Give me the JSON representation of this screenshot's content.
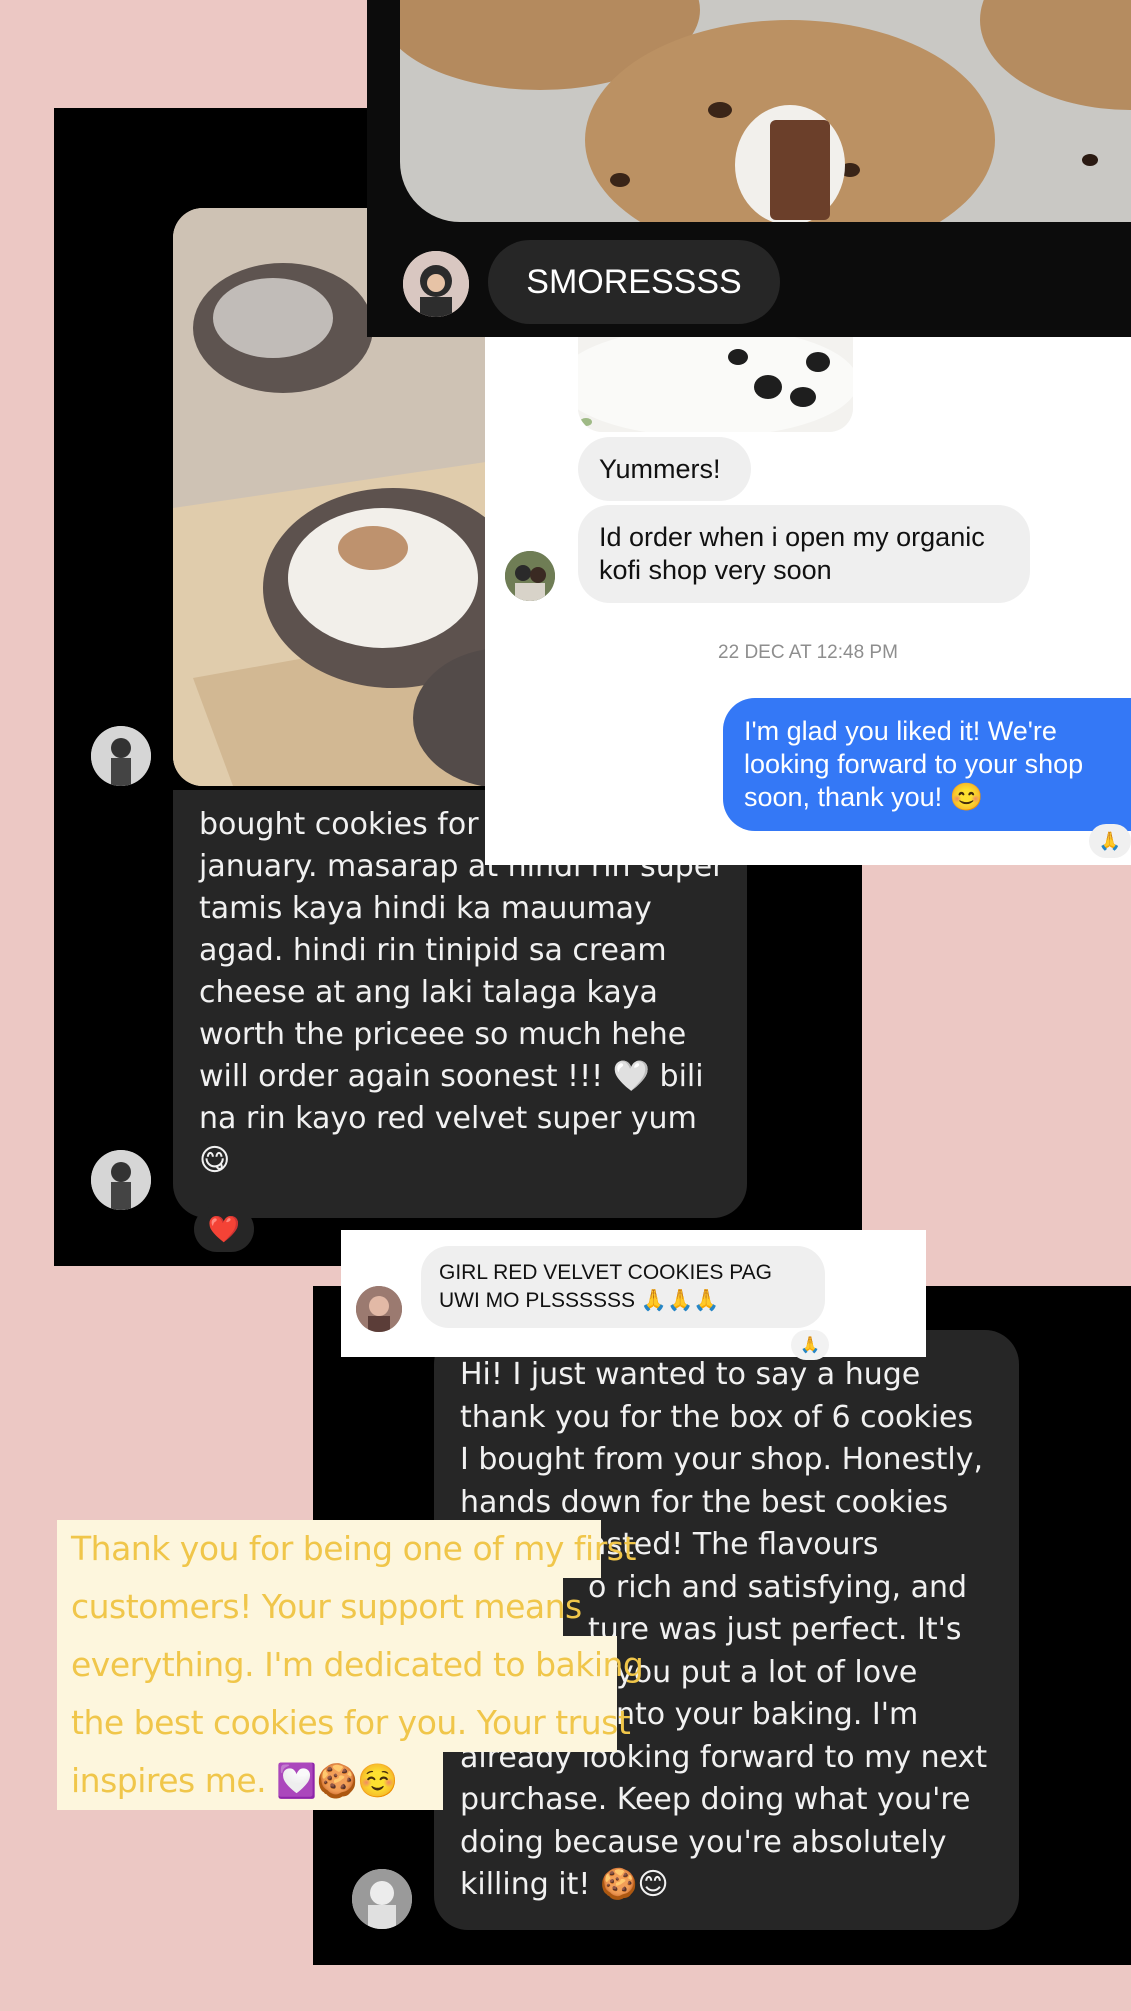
{
  "top_chat": {
    "caption": "SMORESSSS"
  },
  "left_chat": {
    "message": "bought cookies for my family last january. masarap at hindi rin super tamis kaya hindi ka mauumay agad. hindi rin tinipid sa cream cheese at ang laki talaga kaya worth the priceee so much hehe will order again soonest !!! 🤍 bili na rin kayo red velvet super yum 😋",
    "message_lines": [
      "bought cookies for",
      "january. masarap at hindi rin super",
      "tamis kaya hindi ka mauumay",
      "agad. hindi rin tinipid sa cream",
      "cheese at ang laki talaga kaya",
      "worth the priceee so much hehe",
      "will order again soonest !!! 🤍 bili",
      "na rin kayo red velvet super yum",
      "😋"
    ],
    "reaction": "❤️"
  },
  "white_chat": {
    "messages_in": [
      "Yummers!",
      "Id order when i open my organic kofi shop very soon"
    ],
    "msg2_lines": [
      "Id order when i open my organic",
      "kofi shop very soon"
    ],
    "timestamp": "22 DEC AT 12:48 PM",
    "reply_lines": [
      "I'm glad you liked it! We're",
      "looking forward to your shop",
      "soon, thank you! 😊"
    ],
    "reply_reaction": "🙏",
    "colors": {
      "outgoing": "#3478f6",
      "incoming": "#efefef"
    }
  },
  "comment_chat": {
    "lines": [
      "GIRL RED VELVET COOKIES PAG",
      "UWI MO PLSSSSSS 🙏🙏🙏"
    ],
    "reaction": "🙏"
  },
  "bottom_chat": {
    "lines": [
      "Hi! I just wanted to say a huge",
      "thank you for the box of 6 cookies",
      "I bought from your shop. Honestly,",
      "hands down for the best cookies",
      "asted! The flavours",
      "o rich and satisfying, and",
      "ture was just perfect. It's",
      "you put a lot of love",
      "nto your baking. I'm",
      "already looking forward to my next",
      "purchase. Keep doing what you're",
      "doing because you're absolutely",
      "killing it! 🍪😊"
    ]
  },
  "note": {
    "lines": [
      "Thank you for being one of my first",
      "customers! Your support means",
      "everything. I'm dedicated to baking",
      "the best cookies for you. Your trust",
      "inspires me. 💟🍪☺️"
    ],
    "colors": {
      "text": "#f0c64a",
      "background": "#fdf6dd"
    }
  }
}
